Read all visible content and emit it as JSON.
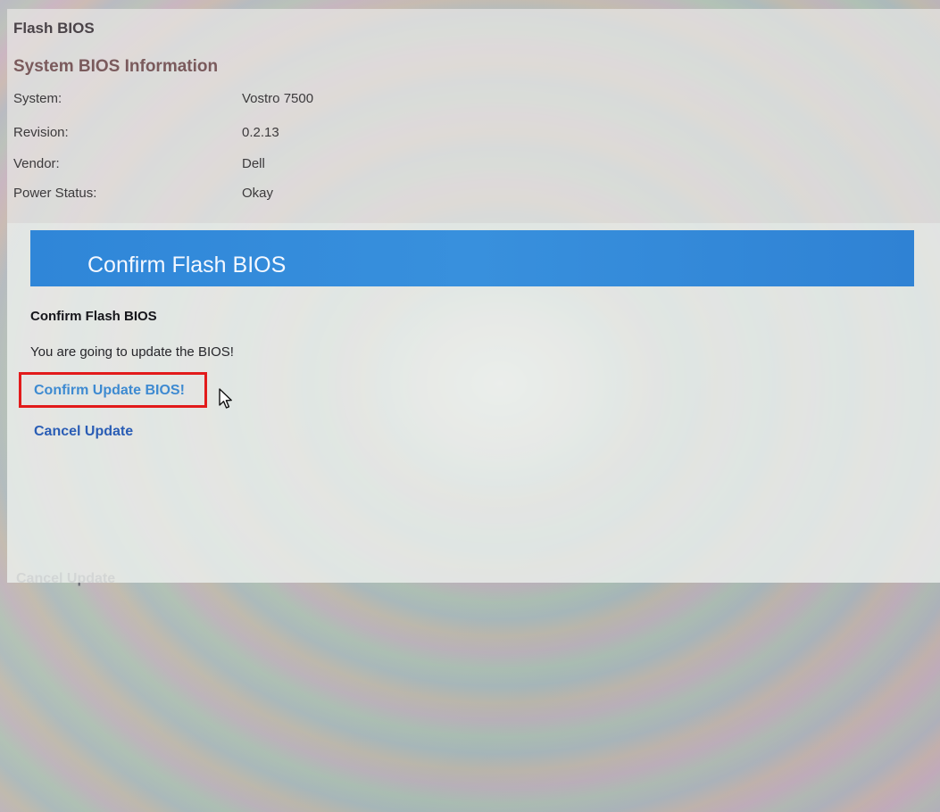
{
  "page": {
    "title": "Flash BIOS",
    "subtitle": "System BIOS Information",
    "info": [
      {
        "label": "System:",
        "value": "Vostro 7500"
      },
      {
        "label": "Revision:",
        "value": "0.2.13"
      },
      {
        "label": "Vendor:",
        "value": "Dell"
      },
      {
        "label": "Power Status:",
        "value": "Okay"
      }
    ],
    "lower_ghost_text": "Cancel Update"
  },
  "dialog": {
    "header_title": "Confirm Flash BIOS",
    "heading": "Confirm Flash BIOS",
    "message": "You are going to update the BIOS!",
    "confirm_label": "Confirm Update BIOS!",
    "cancel_label": "Cancel Update"
  },
  "colors": {
    "header_blue": "#3890dd",
    "confirm_link": "#3d8ad1",
    "cancel_link": "#2a5db5",
    "highlight_red": "#e21b1b",
    "subtitle_brown": "#7a5a5c"
  },
  "icons": {
    "cursor": "mouse-pointer-icon"
  }
}
